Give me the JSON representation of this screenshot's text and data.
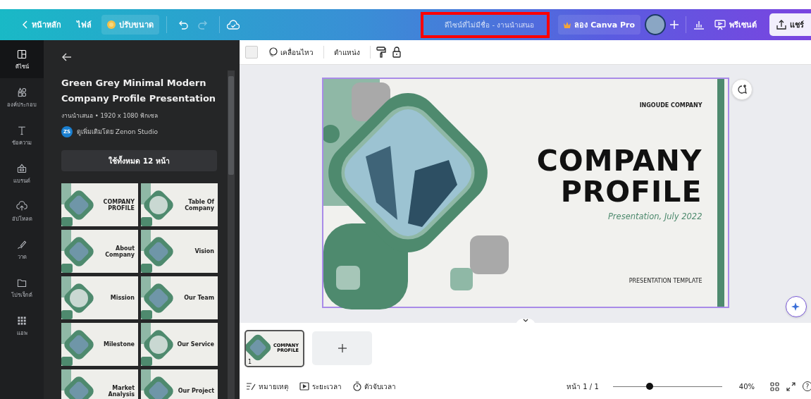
{
  "top_bar": {
    "home": "หน้าหลัก",
    "file": "ไฟล์",
    "resize": "ปรับขนาด",
    "history": [
      {
        "kind": "undo",
        "disabled": false
      },
      {
        "kind": "redo",
        "disabled": true
      }
    ],
    "title": {
      "text": "ดีไซน์ที่ไม่มีชื่อ - งานนำเสนอ",
      "highlighted": true
    },
    "try_pro": "ลอง Canva Pro",
    "present": "พรีเซนต์",
    "share": "แชร์"
  },
  "rail": [
    {
      "kind": "design",
      "label": "ดีไซน์",
      "selected": true
    },
    {
      "kind": "elements",
      "label": "องค์ประกอบ",
      "selected": false
    },
    {
      "kind": "text",
      "label": "ข้อความ",
      "selected": false
    },
    {
      "kind": "brand",
      "label": "แบรนด์",
      "selected": false
    },
    {
      "kind": "upload",
      "label": "อัปโหลด",
      "selected": false
    },
    {
      "kind": "draw",
      "label": "วาด",
      "selected": false
    },
    {
      "kind": "projects",
      "label": "โปรเจ็กต์",
      "selected": false
    },
    {
      "kind": "apps",
      "label": "แอพ",
      "selected": false
    }
  ],
  "panel": {
    "title": "Green Grey Minimal Modern Company Profile Presentation",
    "meta": "งานนำเสนอ • 1920 x 1080 พิกเซล",
    "author_initials": "ZS",
    "author": "ดูเพิ่มเติมโดย Zenon Studio",
    "use_all": "ใช้ทั้งหมด 12 หน้า",
    "templates": [
      {
        "title": "COMPANY PROFILE"
      },
      {
        "title": "Table Of Company"
      },
      {
        "title": "About Company"
      },
      {
        "title": "Vision"
      },
      {
        "title": "Mission"
      },
      {
        "title": "Our Team"
      },
      {
        "title": "Milestone"
      },
      {
        "title": "Our Service"
      },
      {
        "title": "Market Analysis"
      },
      {
        "title": "Our Project"
      }
    ]
  },
  "toolbar": {
    "animate": "เคลื่อนไหว",
    "position": "ตำแหน่ง"
  },
  "slide": {
    "company": "INGOUDE COMPANY",
    "title_lines": [
      "COMPANY",
      "PROFILE"
    ],
    "subtitle": "Presentation, July 2022",
    "footer": "PRESENTATION TEMPLATE",
    "selected": true
  },
  "pages": [
    {
      "number": "1",
      "title_lines": [
        "COMPANY",
        "PROFILE"
      ],
      "selected": true
    }
  ],
  "bottom_bar": {
    "notes": "หมายเหตุ",
    "duration": "ระยะเวลา",
    "timer": "ตัวจับเวลา",
    "page": "หน้า 1 / 1",
    "zoom": {
      "level": 0.34,
      "reading": "40%"
    },
    "help": "?"
  }
}
